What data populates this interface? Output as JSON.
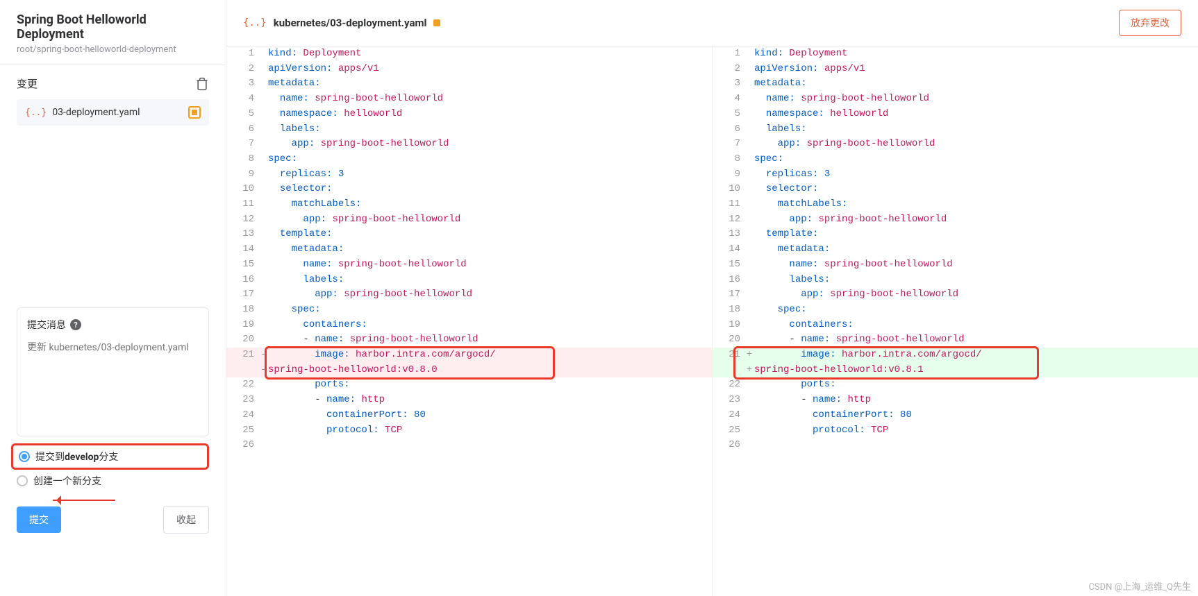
{
  "sidebar": {
    "project_title": "Spring Boot Helloworld Deployment",
    "project_path": "root/spring-boot-helloworld-deployment",
    "changes_label": "变更",
    "file_item": {
      "icon": "{..}",
      "name": "03-deployment.yaml"
    },
    "commit_heading": "提交消息",
    "commit_placeholder": "更新 kubernetes/03-deployment.yaml",
    "branch_option_commit_pre": "提交到",
    "branch_option_commit_branch": "develop",
    "branch_option_commit_post": "分支",
    "branch_option_new": "创建一个新分支",
    "submit_label": "提交",
    "collapse_label": "收起"
  },
  "header": {
    "file_icon": "{..}",
    "file_path": "kubernetes/03-deployment.yaml",
    "discard_label": "放弃更改"
  },
  "diff": {
    "left": [
      {
        "n": 1,
        "seg": [
          [
            "k-key",
            "kind:"
          ],
          [
            "",
            " "
          ],
          [
            "k-val",
            "Deployment"
          ]
        ]
      },
      {
        "n": 2,
        "seg": [
          [
            "k-key",
            "apiVersion:"
          ],
          [
            "",
            " "
          ],
          [
            "k-val",
            "apps/v1"
          ]
        ]
      },
      {
        "n": 3,
        "seg": [
          [
            "k-key",
            "metadata:"
          ]
        ]
      },
      {
        "n": 4,
        "seg": [
          [
            "",
            "  "
          ],
          [
            "k-key",
            "name:"
          ],
          [
            "",
            " "
          ],
          [
            "k-val",
            "spring-boot-helloworld"
          ]
        ]
      },
      {
        "n": 5,
        "seg": [
          [
            "",
            "  "
          ],
          [
            "k-key",
            "namespace:"
          ],
          [
            "",
            " "
          ],
          [
            "k-val",
            "helloworld"
          ]
        ]
      },
      {
        "n": 6,
        "seg": [
          [
            "",
            "  "
          ],
          [
            "k-key",
            "labels:"
          ]
        ]
      },
      {
        "n": 7,
        "seg": [
          [
            "",
            "    "
          ],
          [
            "k-key",
            "app:"
          ],
          [
            "",
            " "
          ],
          [
            "k-val",
            "spring-boot-helloworld"
          ]
        ]
      },
      {
        "n": 8,
        "seg": [
          [
            "k-key",
            "spec:"
          ]
        ]
      },
      {
        "n": 9,
        "seg": [
          [
            "",
            "  "
          ],
          [
            "k-key",
            "replicas:"
          ],
          [
            "",
            " "
          ],
          [
            "k-num",
            "3"
          ]
        ]
      },
      {
        "n": 10,
        "seg": [
          [
            "",
            "  "
          ],
          [
            "k-key",
            "selector:"
          ]
        ]
      },
      {
        "n": 11,
        "seg": [
          [
            "",
            "    "
          ],
          [
            "k-key",
            "matchLabels:"
          ]
        ]
      },
      {
        "n": 12,
        "seg": [
          [
            "",
            "      "
          ],
          [
            "k-key",
            "app:"
          ],
          [
            "",
            " "
          ],
          [
            "k-val",
            "spring-boot-helloworld"
          ]
        ]
      },
      {
        "n": 13,
        "seg": [
          [
            "",
            "  "
          ],
          [
            "k-key",
            "template:"
          ]
        ]
      },
      {
        "n": 14,
        "seg": [
          [
            "",
            "    "
          ],
          [
            "k-key",
            "metadata:"
          ]
        ]
      },
      {
        "n": 15,
        "seg": [
          [
            "",
            "      "
          ],
          [
            "k-key",
            "name:"
          ],
          [
            "",
            " "
          ],
          [
            "k-val",
            "spring-boot-helloworld"
          ]
        ]
      },
      {
        "n": 16,
        "seg": [
          [
            "",
            "      "
          ],
          [
            "k-key",
            "labels:"
          ]
        ]
      },
      {
        "n": 17,
        "seg": [
          [
            "",
            "        "
          ],
          [
            "k-key",
            "app:"
          ],
          [
            "",
            " "
          ],
          [
            "k-val",
            "spring-boot-helloworld"
          ]
        ]
      },
      {
        "n": 18,
        "seg": [
          [
            "",
            "    "
          ],
          [
            "k-key",
            "spec:"
          ]
        ]
      },
      {
        "n": 19,
        "seg": [
          [
            "",
            "      "
          ],
          [
            "k-key",
            "containers:"
          ]
        ]
      },
      {
        "n": 20,
        "seg": [
          [
            "",
            "      - "
          ],
          [
            "k-key",
            "name:"
          ],
          [
            "",
            " "
          ],
          [
            "k-val",
            "spring-boot-helloworld"
          ]
        ]
      },
      {
        "n": 21,
        "sign": "-",
        "cls": "removed",
        "seg": [
          [
            "",
            "        "
          ],
          [
            "k-key",
            "image:"
          ],
          [
            "",
            " "
          ],
          [
            "k-val",
            "harbor.intra.com/argocd/"
          ]
        ]
      },
      {
        "n": "",
        "sign": "-",
        "cls": "removed",
        "seg": [
          [
            "k-val",
            "spring-boot-helloworld:v0.8.0"
          ]
        ]
      },
      {
        "n": 22,
        "seg": [
          [
            "",
            "        "
          ],
          [
            "k-key",
            "ports:"
          ]
        ]
      },
      {
        "n": 23,
        "seg": [
          [
            "",
            "        - "
          ],
          [
            "k-key",
            "name:"
          ],
          [
            "",
            " "
          ],
          [
            "k-val",
            "http"
          ]
        ]
      },
      {
        "n": 24,
        "seg": [
          [
            "",
            "          "
          ],
          [
            "k-key",
            "containerPort:"
          ],
          [
            "",
            " "
          ],
          [
            "k-num",
            "80"
          ]
        ]
      },
      {
        "n": 25,
        "seg": [
          [
            "",
            "          "
          ],
          [
            "k-key",
            "protocol:"
          ],
          [
            "",
            " "
          ],
          [
            "k-val",
            "TCP"
          ]
        ]
      },
      {
        "n": 26,
        "seg": [
          [
            "",
            ""
          ]
        ]
      }
    ],
    "right": [
      {
        "n": 1,
        "seg": [
          [
            "k-key",
            "kind:"
          ],
          [
            "",
            " "
          ],
          [
            "k-val",
            "Deployment"
          ]
        ]
      },
      {
        "n": 2,
        "seg": [
          [
            "k-key",
            "apiVersion:"
          ],
          [
            "",
            " "
          ],
          [
            "k-val",
            "apps/v1"
          ]
        ]
      },
      {
        "n": 3,
        "seg": [
          [
            "k-key",
            "metadata:"
          ]
        ]
      },
      {
        "n": 4,
        "seg": [
          [
            "",
            "  "
          ],
          [
            "k-key",
            "name:"
          ],
          [
            "",
            " "
          ],
          [
            "k-val",
            "spring-boot-helloworld"
          ]
        ]
      },
      {
        "n": 5,
        "seg": [
          [
            "",
            "  "
          ],
          [
            "k-key",
            "namespace:"
          ],
          [
            "",
            " "
          ],
          [
            "k-val",
            "helloworld"
          ]
        ]
      },
      {
        "n": 6,
        "seg": [
          [
            "",
            "  "
          ],
          [
            "k-key",
            "labels:"
          ]
        ]
      },
      {
        "n": 7,
        "seg": [
          [
            "",
            "    "
          ],
          [
            "k-key",
            "app:"
          ],
          [
            "",
            " "
          ],
          [
            "k-val",
            "spring-boot-helloworld"
          ]
        ]
      },
      {
        "n": 8,
        "seg": [
          [
            "k-key",
            "spec:"
          ]
        ]
      },
      {
        "n": 9,
        "seg": [
          [
            "",
            "  "
          ],
          [
            "k-key",
            "replicas:"
          ],
          [
            "",
            " "
          ],
          [
            "k-num",
            "3"
          ]
        ]
      },
      {
        "n": 10,
        "seg": [
          [
            "",
            "  "
          ],
          [
            "k-key",
            "selector:"
          ]
        ]
      },
      {
        "n": 11,
        "seg": [
          [
            "",
            "    "
          ],
          [
            "k-key",
            "matchLabels:"
          ]
        ]
      },
      {
        "n": 12,
        "seg": [
          [
            "",
            "      "
          ],
          [
            "k-key",
            "app:"
          ],
          [
            "",
            " "
          ],
          [
            "k-val",
            "spring-boot-helloworld"
          ]
        ]
      },
      {
        "n": 13,
        "seg": [
          [
            "",
            "  "
          ],
          [
            "k-key",
            "template:"
          ]
        ]
      },
      {
        "n": 14,
        "seg": [
          [
            "",
            "    "
          ],
          [
            "k-key",
            "metadata:"
          ]
        ]
      },
      {
        "n": 15,
        "seg": [
          [
            "",
            "      "
          ],
          [
            "k-key",
            "name:"
          ],
          [
            "",
            " "
          ],
          [
            "k-val",
            "spring-boot-helloworld"
          ]
        ]
      },
      {
        "n": 16,
        "seg": [
          [
            "",
            "      "
          ],
          [
            "k-key",
            "labels:"
          ]
        ]
      },
      {
        "n": 17,
        "seg": [
          [
            "",
            "        "
          ],
          [
            "k-key",
            "app:"
          ],
          [
            "",
            " "
          ],
          [
            "k-val",
            "spring-boot-helloworld"
          ]
        ]
      },
      {
        "n": 18,
        "seg": [
          [
            "",
            "    "
          ],
          [
            "k-key",
            "spec:"
          ]
        ]
      },
      {
        "n": 19,
        "seg": [
          [
            "",
            "      "
          ],
          [
            "k-key",
            "containers:"
          ]
        ]
      },
      {
        "n": 20,
        "seg": [
          [
            "",
            "      - "
          ],
          [
            "k-key",
            "name:"
          ],
          [
            "",
            " "
          ],
          [
            "k-val",
            "spring-boot-helloworld"
          ]
        ]
      },
      {
        "n": 21,
        "sign": "+",
        "cls": "added",
        "seg": [
          [
            "",
            "        "
          ],
          [
            "k-key",
            "image:"
          ],
          [
            "",
            " "
          ],
          [
            "k-val",
            "harbor.intra.com/argocd/"
          ]
        ]
      },
      {
        "n": "",
        "sign": "+",
        "cls": "added",
        "seg": [
          [
            "k-val",
            "spring-boot-helloworld:v0.8.1"
          ]
        ]
      },
      {
        "n": 22,
        "seg": [
          [
            "",
            "        "
          ],
          [
            "k-key",
            "ports:"
          ]
        ]
      },
      {
        "n": 23,
        "seg": [
          [
            "",
            "        - "
          ],
          [
            "k-key",
            "name:"
          ],
          [
            "",
            " "
          ],
          [
            "k-val",
            "http"
          ]
        ]
      },
      {
        "n": 24,
        "seg": [
          [
            "",
            "          "
          ],
          [
            "k-key",
            "containerPort:"
          ],
          [
            "",
            " "
          ],
          [
            "k-num",
            "80"
          ]
        ]
      },
      {
        "n": 25,
        "seg": [
          [
            "",
            "          "
          ],
          [
            "k-key",
            "protocol:"
          ],
          [
            "",
            " "
          ],
          [
            "k-val",
            "TCP"
          ]
        ]
      },
      {
        "n": 26,
        "seg": [
          [
            "",
            ""
          ]
        ]
      }
    ]
  },
  "watermark": "CSDN @上海_运维_Q先生"
}
